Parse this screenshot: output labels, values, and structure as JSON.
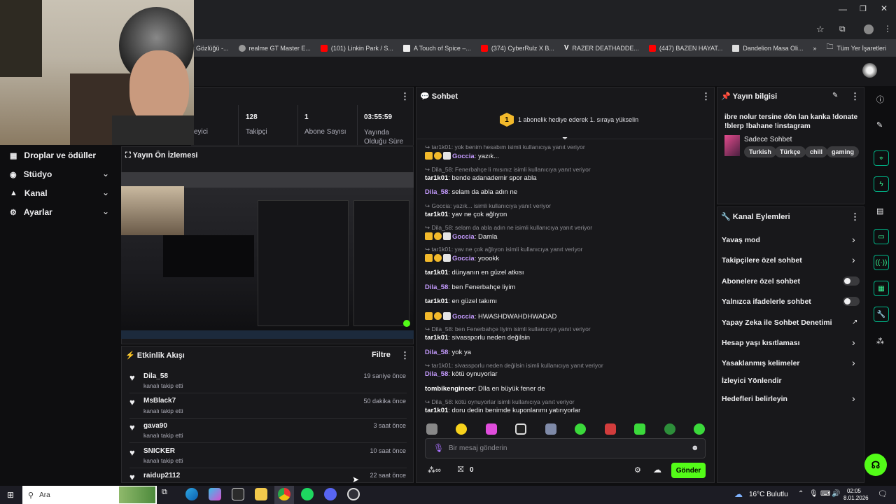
{
  "browser": {
    "bookmarks": [
      {
        "label": "ışık Gözlüğü -..."
      },
      {
        "label": "realme GT Master E..."
      },
      {
        "label": "(101) Linkin Park / S..."
      },
      {
        "label": "A Touch of Spice –..."
      },
      {
        "label": "(374) CyberRulz X B..."
      },
      {
        "label": "RAZER DEATHADDE..."
      },
      {
        "label": "(447) BAZEN HAYAT..."
      },
      {
        "label": "Dandelion Masa Oli..."
      }
    ],
    "all_bookmarks": "Tüm Yer İşaretleri",
    "more": "»"
  },
  "stats": {
    "partial_label": "eyici",
    "followers_value": "128",
    "followers_label": "Takipçi",
    "subs_value": "1",
    "subs_label": "Abone Sayısı",
    "uptime_value": "03:55:59",
    "uptime_label": "Yayında Olduğu Süre"
  },
  "nav": {
    "items": [
      {
        "label": "Droplar ve ödüller"
      },
      {
        "label": "Stüdyo"
      },
      {
        "label": "Kanal"
      },
      {
        "label": "Ayarlar"
      }
    ]
  },
  "preview": {
    "title": "Yayın Ön İzlemesi"
  },
  "feed": {
    "title": "Etkinlik Akışı",
    "filter": "Filtre",
    "items": [
      {
        "name": "Dila_58",
        "sub": "kanalı takip etti",
        "time": "19 saniye önce"
      },
      {
        "name": "MsBlack7",
        "sub": "kanalı takip etti",
        "time": "50 dakika önce"
      },
      {
        "name": "gava90",
        "sub": "kanalı takip etti",
        "time": "3 saat önce"
      },
      {
        "name": "SNICKER",
        "sub": "kanalı takip etti",
        "time": "10 saat önce"
      },
      {
        "name": "raidup2112",
        "sub": "",
        "time": "22 saat önce"
      }
    ]
  },
  "chat": {
    "title": "Sohbet",
    "gift_count": "1",
    "gift_text": "1 abonelik hediye ederek 1. sıraya yükselin",
    "lines": [
      {
        "reply": "tar1k01: yok benim hesabım isimli kullanıcıya yanıt veriyor",
        "user": "Goccia",
        "msg": ": yazık..."
      },
      {
        "reply": "Dila_58: Fenerbahçe li mısınız isimli kullanıcıya yanıt veriyor",
        "user": "tar1k01",
        "msg": ": bende adanademir spor abla"
      },
      {
        "reply": "",
        "user": "Dila_58",
        "msg": ": selam da abla adın ne"
      },
      {
        "reply": "Goccia: yazık... isimli kullanıcıya yanıt veriyor",
        "user": "tar1k01",
        "msg": ": yav ne çok ağlıyon"
      },
      {
        "reply": "Dila_58: selam da abla adın ne isimli kullanıcıya yanıt veriyor",
        "user": "Goccia",
        "msg": ": Damla"
      },
      {
        "reply": "tar1k01: yav ne çok ağlıyon isimli kullanıcıya yanıt veriyor",
        "user": "Goccia",
        "msg": ": yoookk"
      },
      {
        "reply": "",
        "user": "tar1k01",
        "msg": ": dünyanın en güzel atkısı"
      },
      {
        "reply": "",
        "user": "Dila_58",
        "msg": ": ben Fenerbahçe liyim"
      },
      {
        "reply": "",
        "user": "tar1k01",
        "msg": ": en güzel takımı"
      },
      {
        "reply": "",
        "user": "Goccia",
        "msg": ": HWASHDWAHDHWADAD"
      },
      {
        "reply": "Dila_58: ben Fenerbahçe liyim isimli kullanıcıya yanıt veriyor",
        "user": "tar1k01",
        "msg": ": sivassporlu neden değilsin"
      },
      {
        "reply": "",
        "user": "Dila_58",
        "msg": ": yok ya"
      },
      {
        "reply": "tar1k01: sivassporlu neden değilsin isimli kullanıcıya yanıt veriyor",
        "user": "Dila_58",
        "msg": ": kötü oynuyorlar"
      },
      {
        "reply": "",
        "user": "tombikengineer",
        "msg": ": DIla en büyük fener de"
      },
      {
        "reply": "Dila_58: kötü oynuyorlar isimli kullanıcıya yanıt veriyor",
        "user": "tar1k01",
        "msg": ": doru dedin benimde kuponlarımı yatırıyorlar"
      }
    ],
    "input_placeholder": "Bir mesaj gönderin",
    "points": "0",
    "send": "Gönder"
  },
  "stream_info": {
    "title": "Yayın bilgisi",
    "description": "ibre nolur tersine dön lan kanka !donate !blerp !bahane !instagram",
    "category": "Sadece Sohbet",
    "tags": [
      "Turkish",
      "Türkçe",
      "chill",
      "gaming"
    ]
  },
  "actions": {
    "title": "Kanal Eylemleri",
    "items": [
      {
        "label": "Yavaş mod"
      },
      {
        "label": "Takipçilere özel sohbet"
      },
      {
        "label": "Abonelere özel sohbet"
      },
      {
        "label": "Yalnızca ifadelerle sohbet"
      },
      {
        "label": "Yapay Zeka ile Sohbet Denetimi"
      },
      {
        "label": "Hesap yaşı kısıtlaması"
      },
      {
        "label": "Yasaklanmış kelimeler"
      },
      {
        "label": "İzleyici Yönlendir"
      },
      {
        "label": "Hedefleri belirleyin"
      }
    ]
  },
  "taskbar": {
    "search": "Ara",
    "weather": "16°C Bulutlu",
    "time": "02:05",
    "date": "8.01.2026"
  },
  "colors": {
    "accent": "#53fc18",
    "badge_green": "#00b386"
  }
}
